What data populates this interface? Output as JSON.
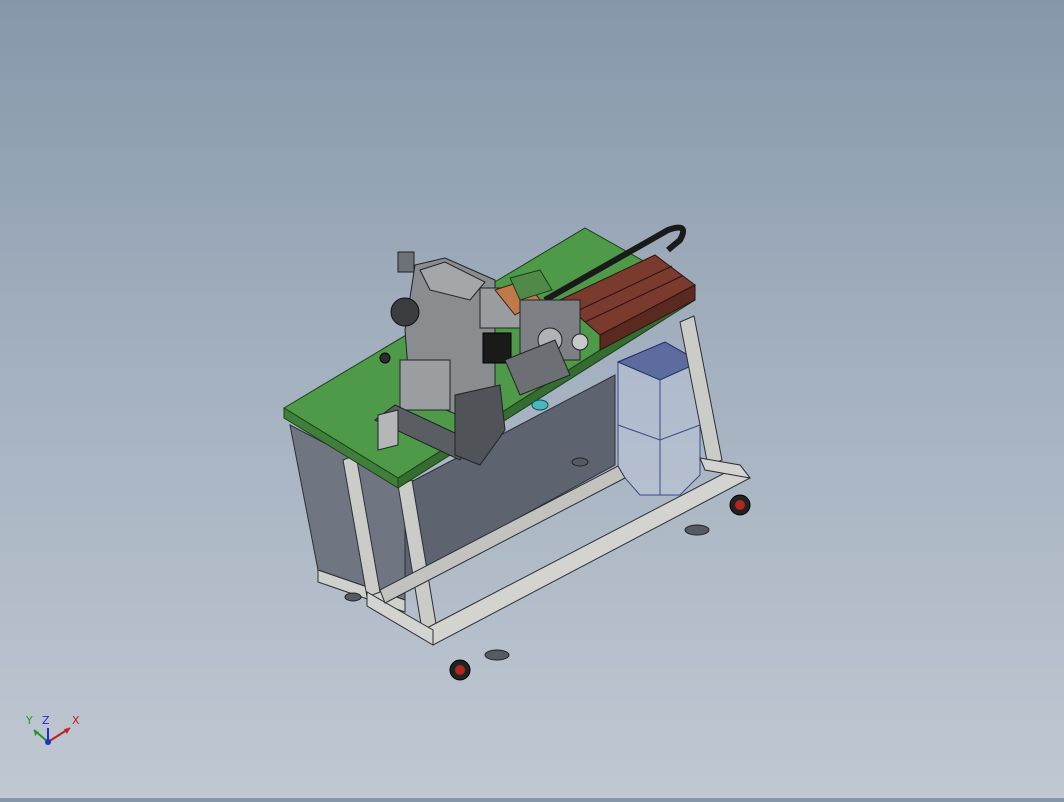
{
  "viewport": {
    "background_top": "#8797aa",
    "background_bottom": "#c0c8d2"
  },
  "model": {
    "table_top_color": "#4f9a48",
    "frame_color": "#c9cac6",
    "cabinet_color": "#6e7480",
    "mechanism_color": "#8a8d90",
    "feeder_color": "#7a3a2e",
    "chain_color": "#1a1a1a",
    "bin_color": "#3a4a8a",
    "wheel_color": "#b0271f"
  },
  "triad": {
    "y_label": "Y",
    "z_label": "Z",
    "x_label": "X",
    "y_color": "#1f9a2a",
    "z_color": "#1a2fd0",
    "x_color": "#c0201a"
  }
}
